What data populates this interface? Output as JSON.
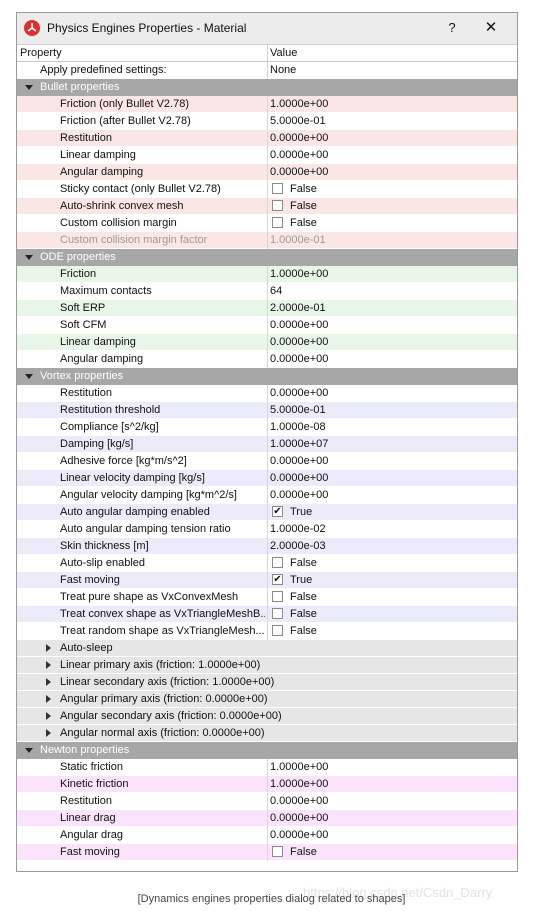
{
  "window": {
    "title": "Physics Engines Properties - Material",
    "help_label": "?",
    "close_label": "✕"
  },
  "header": {
    "property": "Property",
    "value": "Value"
  },
  "top": {
    "label": "Apply predefined settings:",
    "value": "None"
  },
  "bullet": {
    "title": "Bullet properties",
    "rows": [
      {
        "label": "Friction (only Bullet V2.78)",
        "value": "1.0000e+00"
      },
      {
        "label": "Friction (after Bullet V2.78)",
        "value": "5.0000e-01"
      },
      {
        "label": "Restitution",
        "value": "0.0000e+00"
      },
      {
        "label": "Linear damping",
        "value": "0.0000e+00"
      },
      {
        "label": "Angular damping",
        "value": "0.0000e+00"
      },
      {
        "label": "Sticky contact (only Bullet V2.78)",
        "value": "False"
      },
      {
        "label": "Auto-shrink convex mesh",
        "value": "False"
      },
      {
        "label": "Custom collision margin",
        "value": "False"
      },
      {
        "label": "Custom collision margin factor",
        "value": "1.0000e-01"
      }
    ]
  },
  "ode": {
    "title": "ODE properties",
    "rows": [
      {
        "label": "Friction",
        "value": "1.0000e+00"
      },
      {
        "label": "Maximum contacts",
        "value": "64"
      },
      {
        "label": "Soft ERP",
        "value": "2.0000e-01"
      },
      {
        "label": "Soft CFM",
        "value": "0.0000e+00"
      },
      {
        "label": "Linear damping",
        "value": "0.0000e+00"
      },
      {
        "label": "Angular damping",
        "value": "0.0000e+00"
      }
    ]
  },
  "vortex": {
    "title": "Vortex properties",
    "rows": [
      {
        "label": "Restitution",
        "value": "0.0000e+00"
      },
      {
        "label": "Restitution threshold",
        "value": "5.0000e-01"
      },
      {
        "label": "Compliance [s^2/kg]",
        "value": "1.0000e-08"
      },
      {
        "label": "Damping [kg/s]",
        "value": "1.0000e+07"
      },
      {
        "label": "Adhesive force [kg*m/s^2]",
        "value": "0.0000e+00"
      },
      {
        "label": "Linear velocity damping [kg/s]",
        "value": "0.0000e+00"
      },
      {
        "label": "Angular velocity damping [kg*m^2/s]",
        "value": "0.0000e+00"
      },
      {
        "label": "Auto angular damping enabled",
        "value": "True"
      },
      {
        "label": "Auto angular damping tension ratio",
        "value": "1.0000e-02"
      },
      {
        "label": "Skin thickness [m]",
        "value": "2.0000e-03"
      },
      {
        "label": "Auto-slip enabled",
        "value": "False"
      },
      {
        "label": "Fast moving",
        "value": "True"
      },
      {
        "label": "Treat pure shape as VxConvexMesh",
        "value": "False"
      },
      {
        "label": "Treat convex shape as VxTriangleMeshB...",
        "value": "False"
      },
      {
        "label": "Treat random shape as VxTriangleMesh...",
        "value": "False"
      }
    ],
    "groups": [
      "Auto-sleep",
      "Linear primary axis (friction: 1.0000e+00)",
      "Linear secondary axis (friction: 1.0000e+00)",
      "Angular primary axis (friction: 0.0000e+00)",
      "Angular secondary axis (friction: 0.0000e+00)",
      "Angular normal axis (friction: 0.0000e+00)"
    ]
  },
  "newton": {
    "title": "Newton properties",
    "rows": [
      {
        "label": "Static friction",
        "value": "1.0000e+00"
      },
      {
        "label": "Kinetic friction",
        "value": "1.0000e+00"
      },
      {
        "label": "Restitution",
        "value": "0.0000e+00"
      },
      {
        "label": "Linear drag",
        "value": "0.0000e+00"
      },
      {
        "label": "Angular drag",
        "value": "0.0000e+00"
      },
      {
        "label": "Fast moving",
        "value": "False"
      }
    ]
  },
  "checkmark": "✔",
  "caption": "[Dynamics engines properties dialog related to shapes]",
  "watermark": "https://blog.csdn.net/Csdn_Darry"
}
